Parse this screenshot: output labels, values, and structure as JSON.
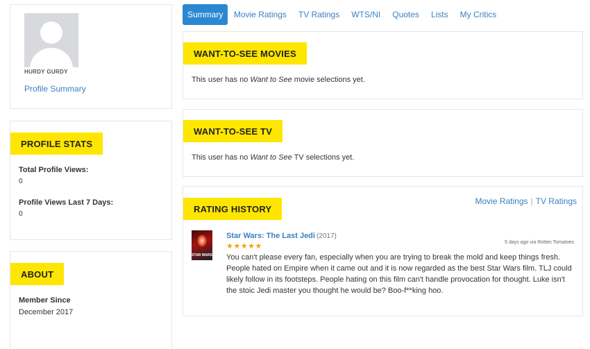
{
  "profile": {
    "username": "HURDY GURDY",
    "summary_link": "Profile Summary"
  },
  "stats": {
    "heading": "PROFILE STATS",
    "total_views_label": "Total Profile Views:",
    "total_views_value": "0",
    "views_7days_label": "Profile Views Last 7 Days:",
    "views_7days_value": "0"
  },
  "about": {
    "heading": "ABOUT",
    "member_since_label": "Member Since",
    "member_since_value": "December 2017"
  },
  "tabs": [
    {
      "label": "Summary",
      "active": true
    },
    {
      "label": "Movie Ratings"
    },
    {
      "label": "TV Ratings"
    },
    {
      "label": "WTS/NI"
    },
    {
      "label": "Quotes"
    },
    {
      "label": "Lists"
    },
    {
      "label": "My Critics"
    }
  ],
  "wts_movies": {
    "heading": "WANT-TO-SEE MOVIES",
    "msg_before": "This user has no ",
    "msg_em": "Want to See",
    "msg_after": " movie selections yet."
  },
  "wts_tv": {
    "heading": "WANT-TO-SEE TV",
    "msg_before": "This user has no ",
    "msg_em": "Want to See",
    "msg_after": " TV selections yet."
  },
  "rating_history": {
    "heading": "RATING HISTORY",
    "link_movies": "Movie Ratings",
    "link_separator": "|",
    "link_tv": "TV Ratings",
    "item": {
      "title": "Star Wars: The Last Jedi",
      "year": "(2017)",
      "stars": "★★★★★",
      "rating": 5,
      "meta": "5 days ago via Rotten Tomatoes",
      "poster_text": "STAR WARS",
      "review": "You can't please every fan, especially when you are trying to break the mold and keep things fresh. People hated on Empire when it came out and it is now regarded as the best Star Wars film. TLJ could likely follow in its footsteps. People hating on this film can't handle provocation for thought. Luke isn't the stoic Jedi master you thought he would be? Boo-f**king hoo."
    }
  },
  "colors": {
    "accent_yellow": "#ffe600",
    "link_blue": "#3a7fc1",
    "active_tab": "#2a88d2",
    "star_orange": "#f0a30a"
  }
}
